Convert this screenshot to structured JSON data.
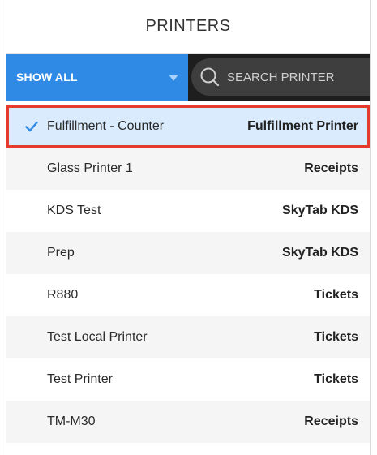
{
  "header": {
    "title": "PRINTERS"
  },
  "toolbar": {
    "filter_label": "SHOW ALL",
    "search_placeholder": "SEARCH PRINTER"
  },
  "colors": {
    "filter_bg": "#2f8ae6",
    "search_bg": "#1e1e1e",
    "selected_bg": "#d9ebfd",
    "selection_outline": "#e53b2c",
    "check_color": "#2f8ae6"
  },
  "printers": [
    {
      "name": "Fulfillment - Counter",
      "type": "Fulfillment Printer",
      "selected": true
    },
    {
      "name": "Glass Printer 1",
      "type": "Receipts",
      "selected": false
    },
    {
      "name": "KDS Test",
      "type": "SkyTab KDS",
      "selected": false
    },
    {
      "name": "Prep",
      "type": "SkyTab KDS",
      "selected": false
    },
    {
      "name": "R880",
      "type": "Tickets",
      "selected": false
    },
    {
      "name": "Test Local Printer",
      "type": "Tickets",
      "selected": false
    },
    {
      "name": "Test Printer",
      "type": "Tickets",
      "selected": false
    },
    {
      "name": "TM-M30",
      "type": "Receipts",
      "selected": false
    }
  ]
}
